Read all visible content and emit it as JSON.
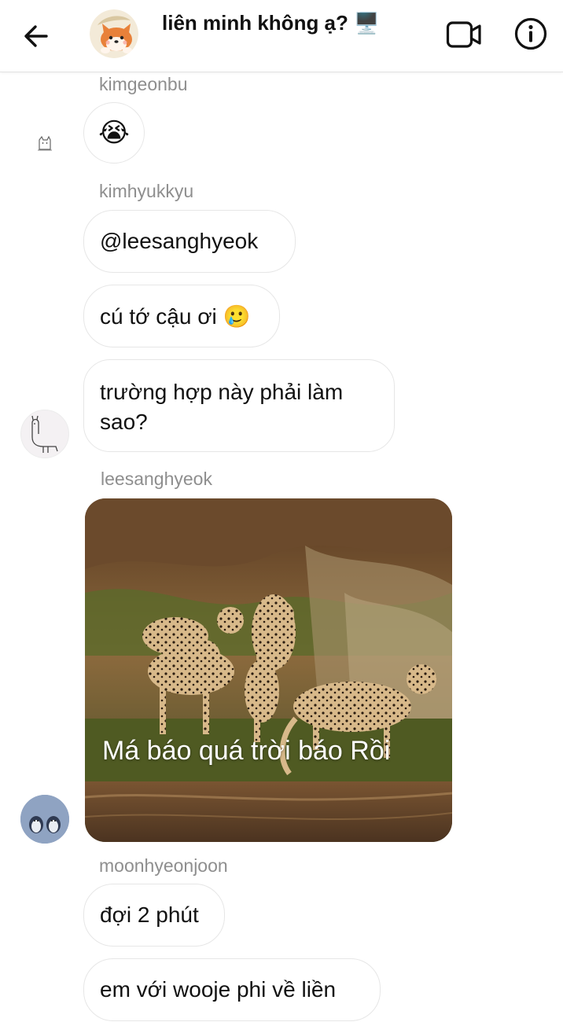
{
  "header": {
    "title": "liên minh không ạ? 🖥️"
  },
  "messages": [
    {
      "sender": "kimgeonbu",
      "emoji": "😭"
    },
    {
      "sender": "kimhyukkyu",
      "texts": [
        "@leesanghyeok",
        "cú tớ cậu ơi 🥲",
        "trường hợp này phải làm sao?"
      ]
    },
    {
      "sender": "leesanghyeok",
      "photo_caption": "Má báo quá trời báo Rồi"
    },
    {
      "sender": "moonhyeonjoon",
      "texts": [
        "đợi 2 phút",
        "em với wooje phi về liền"
      ]
    }
  ],
  "icons": {
    "back": "arrow-left-icon",
    "video": "video-call-icon",
    "info": "info-icon"
  },
  "colors": {
    "sender_name": "#8e8e8e",
    "bubble_border": "#e6e6e6",
    "header_border": "#e3e3e3"
  }
}
